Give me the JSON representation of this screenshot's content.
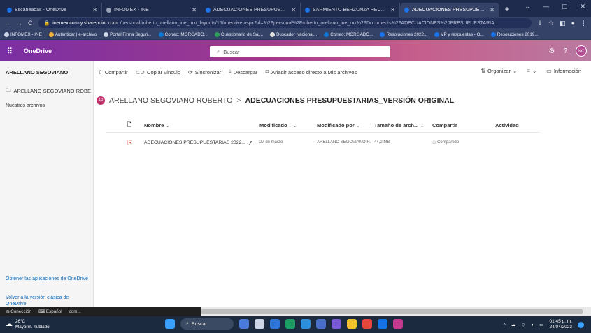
{
  "browser": {
    "tabs": [
      {
        "title": "Escaneadas - OneDrive",
        "icon": "onedrive-icon",
        "active": false
      },
      {
        "title": "INFOMEX - INE",
        "icon": "globe-icon",
        "active": false
      },
      {
        "title": "ADECUACIONES PRESUPUESTAL",
        "icon": "onedrive-icon",
        "active": false
      },
      {
        "title": "SARMIENTO BERZUNZA HECTOI",
        "icon": "onedrive-icon",
        "active": false
      },
      {
        "title": "ADECUACIONES PRESUPUESTAI",
        "icon": "onedrive-icon",
        "active": true
      }
    ],
    "new_tab": "+",
    "url_host": "inemexico-my.sharepoint.com",
    "url_path": "/personal/roberto_arellano_ine_mx/_layouts/15/onedrive.aspx?id=%2Fpersonal%2Froberto_arellano_ine_mx%2FDocuments%2FADECUACIONES%20PRESUPUESTARIA...",
    "bookmarks": [
      "INFOMEX - INE",
      "Autenticar | e-archivo",
      "Portal Firma Seguri...",
      "Correo: MORGADO...",
      "Cuestionario de Sal...",
      "Buscador Nacional...",
      "Correo: MORGADO...",
      "Resoluciones 2022...",
      "VP y respuestas - O...",
      "Resoluciones 2019..."
    ]
  },
  "onedrive": {
    "brand": "OneDrive",
    "search_placeholder": "Buscar",
    "user_initials": "NC",
    "help": "?"
  },
  "leftnav": {
    "title": "ARELLANO SEGOVIANO",
    "folder_item": "ARELLANO SEGOVIANO ROBE",
    "our_files": "Nuestros archivos",
    "get_apps": "Obtener las aplicaciones de OneDrive",
    "classic": "Volver a la versión clásica de OneDrive"
  },
  "commandbar": {
    "share": "Compartir",
    "copy_link": "Copiar vínculo",
    "sync": "Sincronizar",
    "download": "Descargar",
    "add_shortcut": "Añadir acceso directo a Mis archivos",
    "organize": "Organizar",
    "view": "",
    "info": "Información"
  },
  "breadcrumb": {
    "avatar": "AR",
    "parent": "ARELLANO SEGOVIANO ROBERTO",
    "separator": ">",
    "current": "ADECUACIONES PRESUPUESTARIAS_VERSIÓN ORIGINAL"
  },
  "table": {
    "headers": {
      "name": "Nombre",
      "modified": "Modificado",
      "modified_by": "Modificado por",
      "size": "Tamaño de arch...",
      "sharing": "Compartir",
      "activity": "Actividad"
    },
    "rows": [
      {
        "name": "ADECUACIONES PRESUPUESTARIAS 2022...",
        "modified": "27 de marzo",
        "modified_by": "ARELLANO SEGOVIANO R.",
        "size": "44,2 MB",
        "sharing": "Compartido"
      }
    ]
  },
  "statusbar": {
    "connection": "Conección",
    "language": "Español",
    "extra": "com..."
  },
  "taskbar": {
    "temperature": "26°C",
    "weather": "Mayorm. nublado",
    "search": "Buscar",
    "time": "01:45 p. m.",
    "date": "24/04/2023"
  },
  "colors": {
    "tabstrip": "#1e2b4d",
    "toolbar": "#354268",
    "onedrive_gradient_start": "#7a2fa2",
    "onedrive_gradient_end": "#c65e8c",
    "link": "#0f6cbd",
    "taskbar": "#1b2a3f"
  }
}
